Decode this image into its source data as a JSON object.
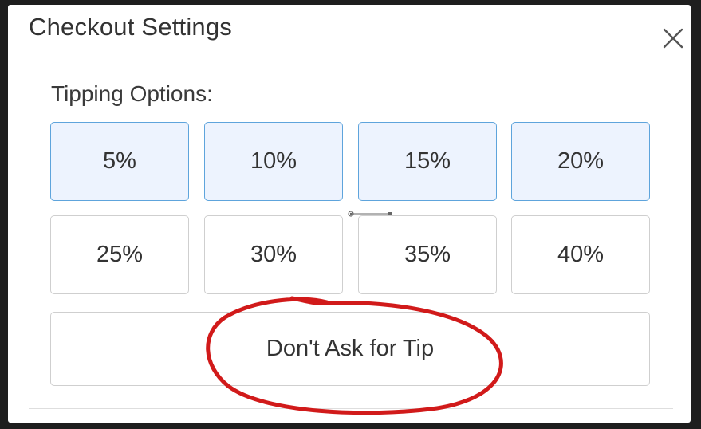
{
  "dialog": {
    "title": "Checkout Settings",
    "close_icon": "close-icon"
  },
  "tipping": {
    "label": "Tipping Options:",
    "options": [
      {
        "label": "5%",
        "selected": true
      },
      {
        "label": "10%",
        "selected": true
      },
      {
        "label": "15%",
        "selected": true
      },
      {
        "label": "20%",
        "selected": true
      },
      {
        "label": "25%",
        "selected": false
      },
      {
        "label": "30%",
        "selected": false
      },
      {
        "label": "35%",
        "selected": false
      },
      {
        "label": "40%",
        "selected": false
      }
    ],
    "dont_ask_label": "Don't Ask for Tip"
  },
  "colors": {
    "selected_fill": "#edf3fe",
    "selected_border": "#5ea4dc",
    "annotation": "#d11a1a"
  }
}
